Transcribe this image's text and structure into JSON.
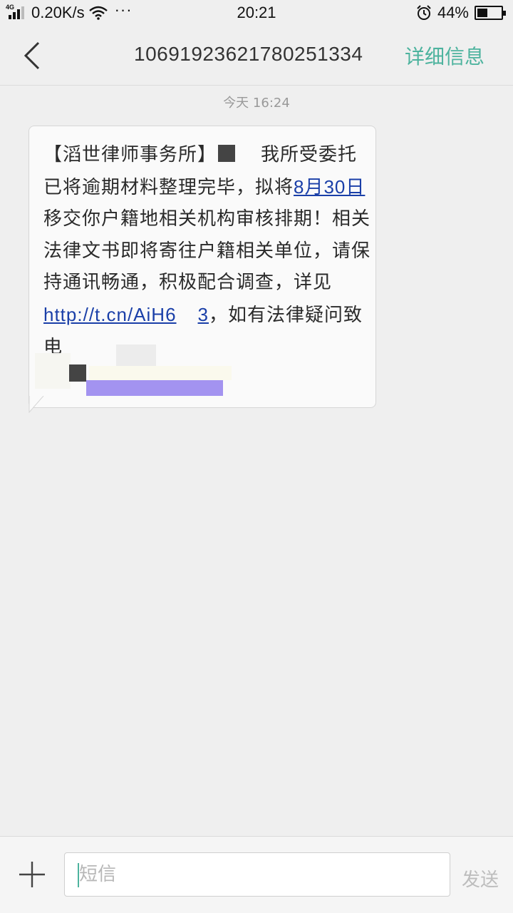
{
  "status_bar": {
    "network_type": "4G",
    "speed": "0.20K/s",
    "more": "···",
    "time": "20:21",
    "battery_percent": "44%",
    "battery_level": 0.44
  },
  "header": {
    "sender_number": "1069192362178025133​4",
    "detail_label": "详细信息"
  },
  "timestamp": "今天  16:24",
  "message": {
    "seg1": "【滔世律师事务所】",
    "seg2": "我所受委托已将逾期材料整理完毕，拟将",
    "date_link": "8月30日",
    "seg3": "移交你户籍地相关机构审核排期！相关法律文书即将寄往户籍相关单位，请保持通讯畅通，积极配合调查，详见",
    "url_link": "http://t.cn/AiH6",
    "url_tail": "3",
    "seg4": "，如有法律疑问致电"
  },
  "input": {
    "placeholder": "短信",
    "send_label": "发送"
  }
}
